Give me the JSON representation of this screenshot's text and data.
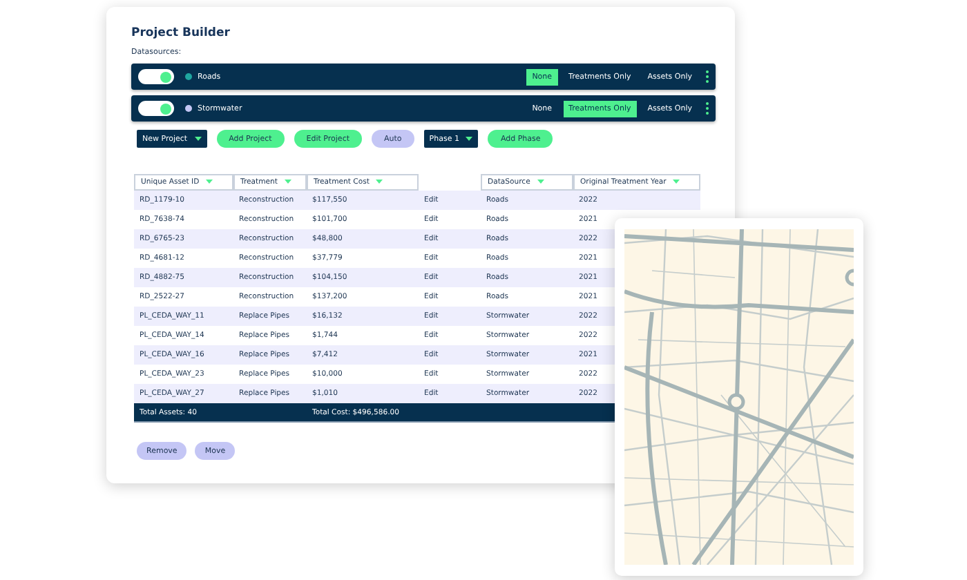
{
  "title": "Project Builder",
  "datasources_label": "Datasources:",
  "datasources": [
    {
      "name": "Roads",
      "on": true,
      "color": "#1fa6a0",
      "options": [
        {
          "label": "None",
          "selected": true
        },
        {
          "label": "Treatments Only",
          "selected": false
        },
        {
          "label": "Assets Only",
          "selected": false
        }
      ]
    },
    {
      "name": "Stormwater",
      "on": true,
      "color": "#c3c6f4",
      "options": [
        {
          "label": "None",
          "selected": false
        },
        {
          "label": "Treatments Only",
          "selected": true
        },
        {
          "label": "Assets Only",
          "selected": false
        }
      ]
    }
  ],
  "toolbar": [
    {
      "kind": "dropdown",
      "label": "New Project"
    },
    {
      "kind": "primary",
      "label": "Add Project"
    },
    {
      "kind": "primary",
      "label": "Edit Project"
    },
    {
      "kind": "secondary",
      "label": "Auto"
    },
    {
      "kind": "dropdown",
      "label": "Phase 1"
    },
    {
      "kind": "primary",
      "label": "Add Phase"
    }
  ],
  "table": {
    "columns": [
      {
        "kind": "sortable",
        "label": "Unique Asset ID"
      },
      {
        "kind": "sortable",
        "label": "Treatment"
      },
      {
        "kind": "sortable",
        "label": "Treatment Cost"
      },
      {
        "kind": "blank"
      },
      {
        "kind": "sortable",
        "label": "DataSource"
      },
      {
        "kind": "sortable",
        "label": "Original Treatment Year"
      }
    ],
    "rows": [
      [
        "RD_1179-10",
        "Reconstruction",
        "$117,550",
        "Edit",
        "Roads",
        "2022"
      ],
      [
        "RD_7638-74",
        "Reconstruction",
        "$101,700",
        "Edit",
        "Roads",
        "2021"
      ],
      [
        "RD_6765-23",
        "Reconstruction",
        "$48,800",
        "Edit",
        "Roads",
        "2022"
      ],
      [
        "RD_4681-12",
        "Reconstruction",
        "$37,779",
        "Edit",
        "Roads",
        "2021"
      ],
      [
        "RD_4882-75",
        "Reconstruction",
        "$104,150",
        "Edit",
        "Roads",
        "2021"
      ],
      [
        "RD_2522-27",
        "Reconstruction",
        "$137,200",
        "Edit",
        "Roads",
        "2021"
      ],
      [
        "PL_CEDA_WAY_11",
        "Replace Pipes",
        "$16,132",
        "Edit",
        "Stormwater",
        "2022"
      ],
      [
        "PL_CEDA_WAY_14",
        "Replace Pipes",
        "$1,744",
        "Edit",
        "Stormwater",
        "2022"
      ],
      [
        "PL_CEDA_WAY_16",
        "Replace Pipes",
        "$7,412",
        "Edit",
        "Stormwater",
        "2021"
      ],
      [
        "PL_CEDA_WAY_23",
        "Replace Pipes",
        "$10,000",
        "Edit",
        "Stormwater",
        "2022"
      ],
      [
        "PL_CEDA_WAY_27",
        "Replace Pipes",
        "$1,010",
        "Edit",
        "Stormwater",
        "2022"
      ]
    ],
    "footer": [
      "Total Assets: 40",
      "Total Cost: $496,586.00"
    ]
  },
  "actions": [
    "Remove",
    "Move"
  ],
  "map": {
    "kind": "picture"
  }
}
